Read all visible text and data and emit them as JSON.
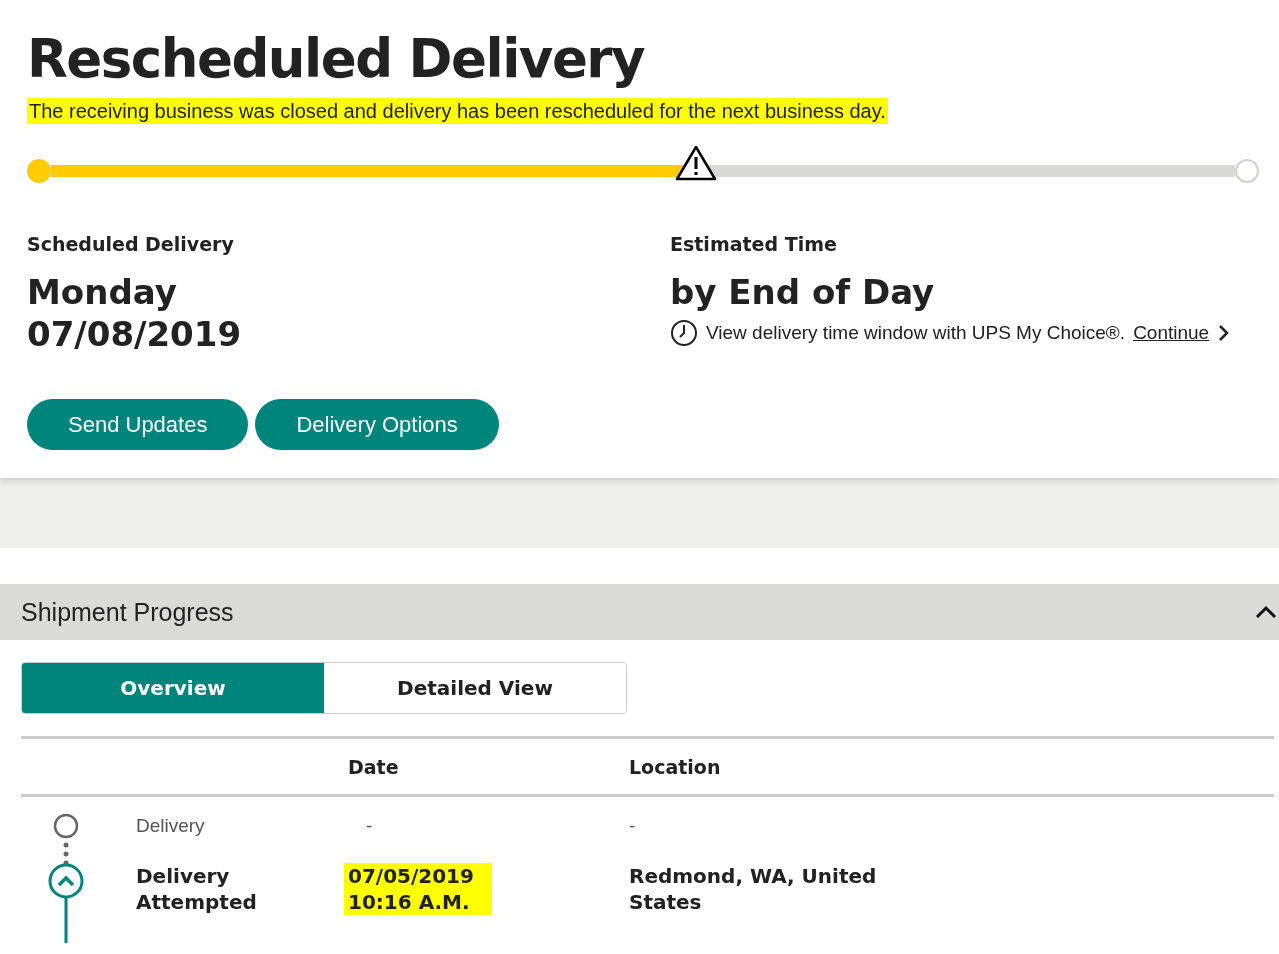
{
  "status": {
    "title": "Rescheduled Delivery",
    "message": "The receiving business was closed and delivery has been rescheduled for the next business day.",
    "message_highlighted": true
  },
  "progress": {
    "level": 0.545,
    "alert": true
  },
  "scheduled": {
    "label": "Scheduled Delivery",
    "day": "Monday",
    "date": "07/08/2019"
  },
  "estimated": {
    "label": "Estimated Time",
    "value": "by End of Day",
    "note": "View delivery time window with UPS My Choice®.",
    "link": "Continue"
  },
  "buttons": [
    "Send Updates",
    "Delivery Options"
  ],
  "shipment_progress": {
    "title": "Shipment Progress",
    "expanded": true,
    "tabs": [
      {
        "label": "Overview",
        "selected": true
      },
      {
        "label": "Detailed View",
        "selected": false
      }
    ],
    "columns": [
      "Date",
      "Location"
    ],
    "rows": [
      {
        "kind": "pending",
        "activity": "Delivery",
        "date": "-",
        "location": "-",
        "date_highlighted": false
      },
      {
        "kind": "current",
        "activity": "Delivery Attempted",
        "date": "07/05/2019 10:16 A.M.",
        "location": "Redmond, WA, United States",
        "date_highlighted": true
      }
    ]
  }
}
